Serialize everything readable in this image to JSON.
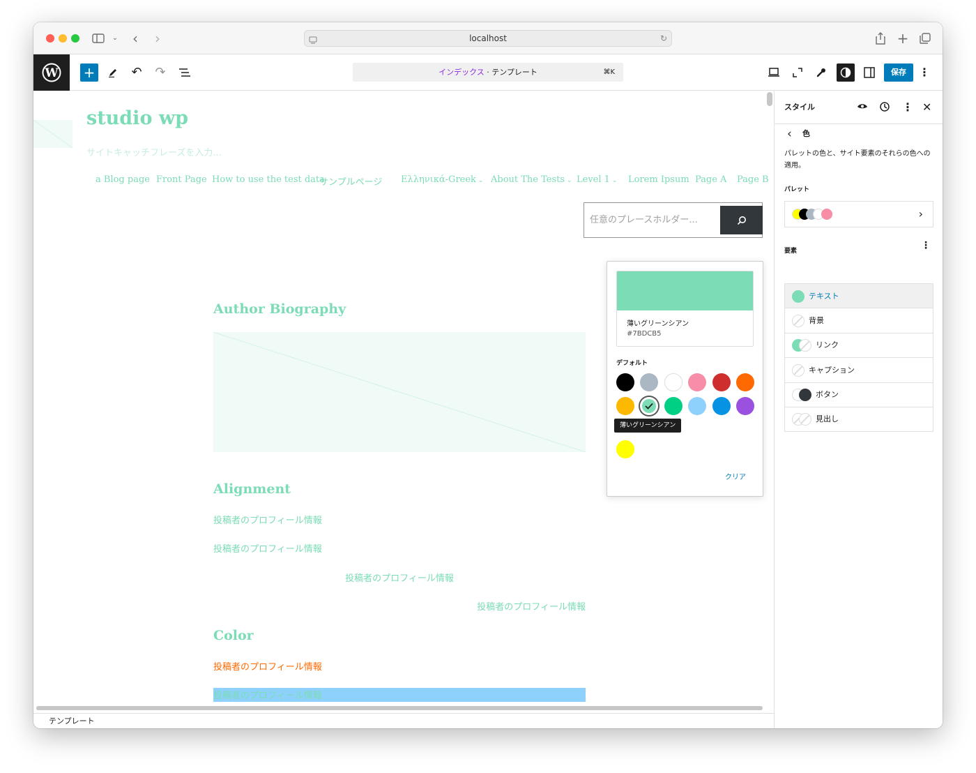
{
  "browser": {
    "url": "localhost"
  },
  "toolbar": {
    "template_name": "インデックス",
    "template_sep": " · テンプレート",
    "shortcut": "⌘K",
    "save_label": "保存"
  },
  "site": {
    "title": "studio wp",
    "tagline_placeholder": "サイトキャッチフレーズを入力...",
    "nav": [
      "a Blog page",
      "Front Page",
      "How to use the test data",
      "サンプルページ",
      "Ελληνικά-Greek",
      "About The Tests",
      "Level 1",
      "Lorem Ipsum",
      "Page A",
      "Page B"
    ],
    "search_placeholder": "任意のプレースホルダー..."
  },
  "content": {
    "h_author": "Author Biography",
    "h_alignment": "Alignment",
    "bio_text": "投稿者のプロフィール情報",
    "h_color": "Color"
  },
  "footer": {
    "label": "テンプレート"
  },
  "sidebar": {
    "title": "スタイル",
    "back_label": "色",
    "description": "パレットの色と、サイト要素のそれらの色への適用。",
    "palette_label": "パレット",
    "elements_label": "要素",
    "elements": [
      "テキスト",
      "背景",
      "リンク",
      "キャプション",
      "ボタン",
      "見出し"
    ]
  },
  "popover": {
    "color_name": "薄いグリーンシアン",
    "color_hex": "#7BDCB5",
    "default_label": "デフォルト",
    "tooltip": "薄いグリーンシアン",
    "clear_label": "クリア"
  },
  "colors": {
    "wp_blue": "#007cba",
    "mint": "#7bdcb5",
    "orange": "#ff6900",
    "pale_cyan_blue": "#8ed1fc",
    "default_palette": [
      "#000000",
      "#abb8c3",
      "#ffffff",
      "#f78da7",
      "#cf2e2e",
      "#ff6900",
      "#fcb900",
      "#7bdcb5",
      "#00d084",
      "#8ed1fc",
      "#0693e3",
      "#9b51e0"
    ],
    "custom_palette": [
      "#ffff00"
    ]
  }
}
